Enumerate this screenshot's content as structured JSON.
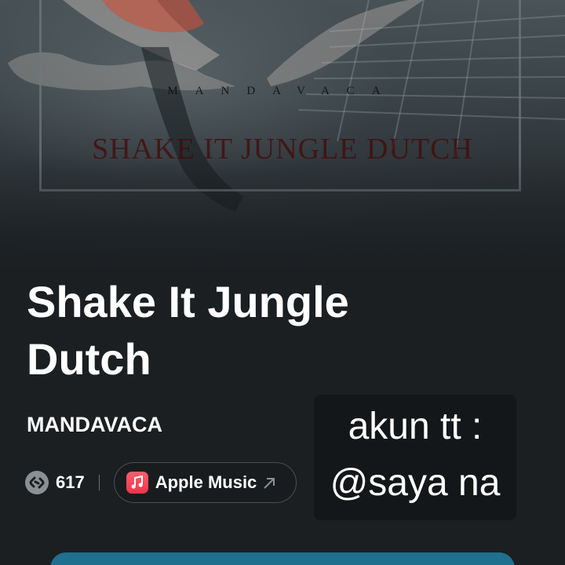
{
  "cover": {
    "artist_text": "MANDAVACA",
    "title_text": "SHAKE IT JUNGLE DUTCH"
  },
  "song": {
    "title": "Shake It Jungle Dutch",
    "artist": "MANDAVACA"
  },
  "stats": {
    "shazam_icon": "shazam-icon",
    "count": "617"
  },
  "apple_music": {
    "icon": "apple-music-icon",
    "label": "Apple Music",
    "arrow_icon": "external-arrow-icon"
  },
  "overlay": {
    "line1": "akun tt :",
    "line2": "@saya na"
  },
  "colors": {
    "background": "#1b1f22",
    "accent": "#1f6f8f",
    "apple_music_red": "#f5334a"
  }
}
